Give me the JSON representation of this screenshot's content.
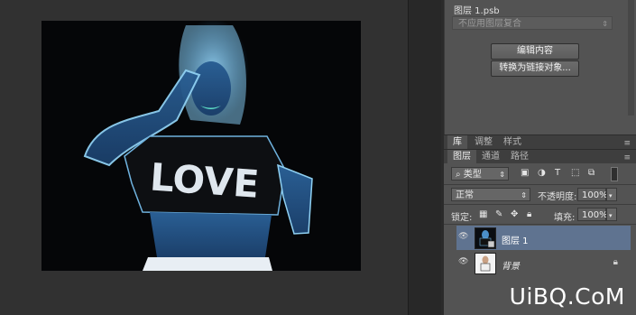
{
  "canvas": {
    "image_text": "LOVE"
  },
  "properties": {
    "layer_name": "图层 1.psb",
    "comp_placeholder": "不应用图层复合",
    "edit_contents_label": "编辑内容",
    "convert_label": "转换为链接对象..."
  },
  "panel_tabs_top": [
    "库",
    "调整",
    "样式"
  ],
  "panel_tabs_layers": [
    "图层",
    "通道",
    "路径"
  ],
  "layers_panel": {
    "filter_kind": "类型",
    "blend_mode": "正常",
    "opacity_label": "不透明度:",
    "opacity_value": "100%",
    "lock_label": "锁定:",
    "fill_label": "填充:",
    "fill_value": "100%",
    "layers": [
      {
        "name": "图层 1",
        "selected": true
      },
      {
        "name": "背景",
        "selected": false,
        "locked": true
      }
    ]
  },
  "watermark": "UiBQ.CoM",
  "colors": {
    "selected_row": "#5f7390",
    "panel_bg": "#535353",
    "canvas_bg": "#313131"
  }
}
